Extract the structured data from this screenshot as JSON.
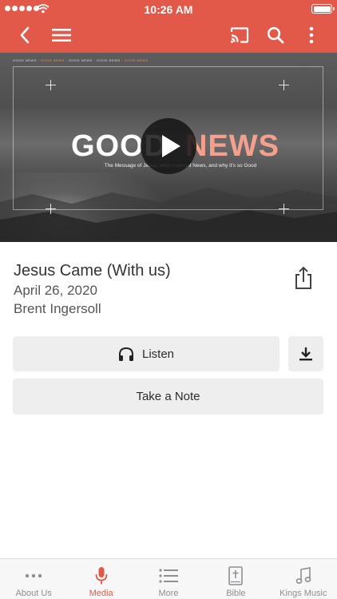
{
  "status_bar": {
    "time": "10:26 AM"
  },
  "nav": {
    "icons": [
      "back-icon",
      "menu-icon",
      "cast-icon",
      "search-icon",
      "more-vertical-icon"
    ]
  },
  "video": {
    "tiny_row": [
      "GOOD NEWS",
      "GOOD NEWS",
      "GOOD NEWS",
      "GOOD NEWS",
      "GOOD NEWS"
    ],
    "title_good": "GOOD",
    "title_news": "NEWS",
    "subtitle": "The Message of Jesus, what makes it News, and why it's so Good",
    "accent_color": "#f5a08c"
  },
  "sermon": {
    "title": "Jesus Came (With us)",
    "date": "April 26, 2020",
    "speaker": "Brent Ingersoll"
  },
  "actions": {
    "listen_label": "Listen",
    "note_label": "Take a Note"
  },
  "tabs": [
    {
      "label": "About Us",
      "icon": "more-horizontal-icon",
      "active": false
    },
    {
      "label": "Media",
      "icon": "microphone-icon",
      "active": true
    },
    {
      "label": "More",
      "icon": "list-icon",
      "active": false
    },
    {
      "label": "Bible",
      "icon": "bible-icon",
      "active": false
    },
    {
      "label": "Kings Music",
      "icon": "music-note-icon",
      "active": false
    }
  ],
  "colors": {
    "brand": "#e2594a",
    "inactive": "#8e8e93",
    "button_bg": "#eeeeef"
  }
}
